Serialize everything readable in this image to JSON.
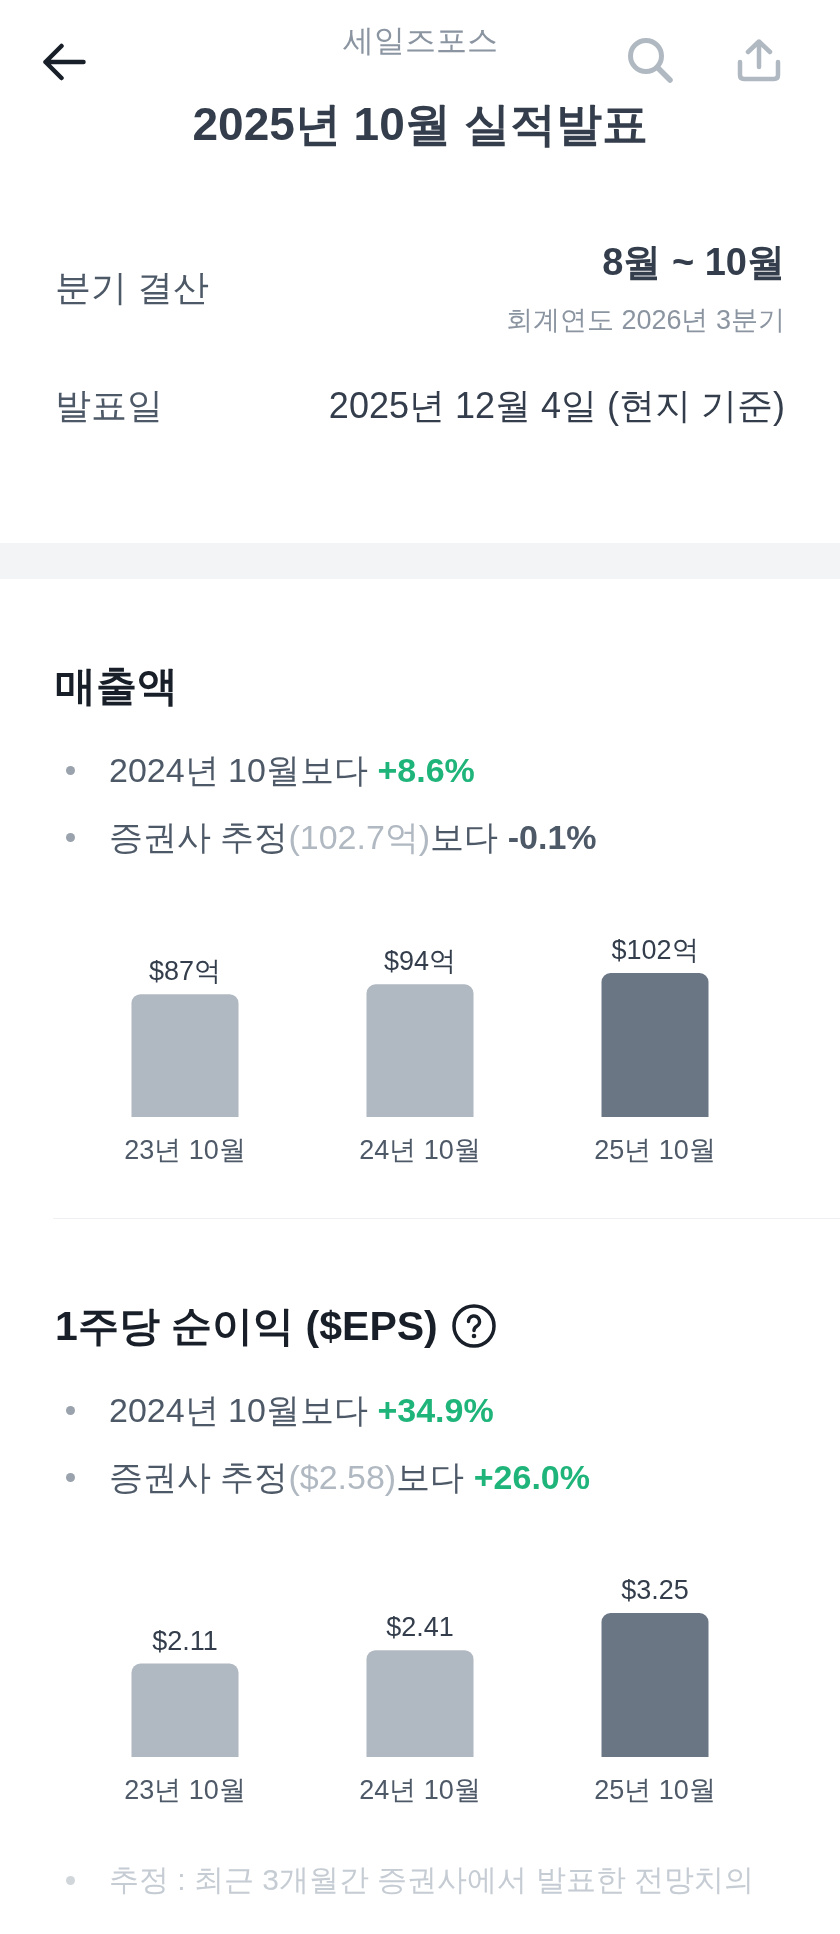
{
  "header": {
    "stock_name": "세일즈포스",
    "title": "2025년 10월 실적발표"
  },
  "summary": {
    "rows": [
      {
        "kind": "period",
        "label": "분기 결산",
        "value": "8월 ~ 10월",
        "note": "회계연도 2026년 3분기"
      },
      {
        "kind": "date",
        "label": "발표일",
        "value": "2025년 12월 4일 (현지 기준)"
      }
    ]
  },
  "sections": [
    {
      "title": "매출액",
      "help": false,
      "bullets": [
        {
          "segments": [
            {
              "kind": "plain",
              "text": "2024년 10월보다"
            },
            {
              "kind": "positive",
              "text": "+8.6%"
            }
          ]
        },
        {
          "segments": [
            {
              "kind": "plain",
              "text": "증권사 추정"
            },
            {
              "kind": "muted",
              "text": "(102.7억)"
            },
            {
              "kind": "plain",
              "text": "보다"
            },
            {
              "kind": "neutral",
              "text": "-0.1%"
            }
          ]
        }
      ],
      "chart_data": {
        "type": "bar",
        "categories": [
          "23년 10월",
          "24년 10월",
          "25년 10월"
        ],
        "series": [
          {
            "color": "#b0b8c1",
            "values": [
              87,
              94,
              null
            ],
            "value_labels": [
              "$87억",
              "$94억",
              null
            ]
          },
          {
            "color": "#6b7684",
            "values": [
              null,
              null,
              102
            ],
            "value_labels": [
              null,
              null,
              "$102억"
            ]
          }
        ],
        "stacked": true
      }
    },
    {
      "title": "1주당 순이익 ($EPS)",
      "help": true,
      "bullets": [
        {
          "segments": [
            {
              "kind": "plain",
              "text": "2024년 10월보다"
            },
            {
              "kind": "positive",
              "text": "+34.9%"
            }
          ]
        },
        {
          "segments": [
            {
              "kind": "plain",
              "text": "증권사 추정"
            },
            {
              "kind": "muted",
              "text": "($2.58)"
            },
            {
              "kind": "plain",
              "text": "보다"
            },
            {
              "kind": "positive",
              "text": "+26.0%"
            }
          ]
        }
      ],
      "chart_data": {
        "type": "bar",
        "categories": [
          "23년 10월",
          "24년 10월",
          "25년 10월"
        ],
        "series": [
          {
            "color": "#b0b8c1",
            "values": [
              2.11,
              2.41,
              null
            ],
            "value_labels": [
              "$2.11",
              "$2.41",
              null
            ]
          },
          {
            "color": "#6b7684",
            "values": [
              null,
              null,
              3.25
            ],
            "value_labels": [
              null,
              null,
              "$3.25"
            ]
          }
        ],
        "stacked": true
      }
    }
  ],
  "footnotes": [
    "추정 : 최근 3개월간 증권사에서 발표한 전망치의"
  ]
}
